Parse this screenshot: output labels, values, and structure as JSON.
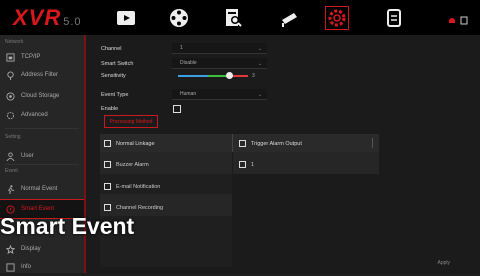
{
  "app": {
    "logo": "XVR",
    "version": "5.0"
  },
  "nav": [
    {
      "icon": "playback-icon"
    },
    {
      "icon": "film-reel-icon"
    },
    {
      "icon": "search-record-icon"
    },
    {
      "icon": "camera-icon"
    },
    {
      "icon": "settings-icon",
      "active": true
    },
    {
      "icon": "document-icon"
    }
  ],
  "sidebar": {
    "section_network": "Network",
    "items": [
      {
        "label": "TCP/IP",
        "icon": "network-port-icon"
      },
      {
        "label": "Address Filter",
        "icon": "location-pin-icon"
      },
      {
        "label": "Cloud Storage",
        "icon": "cloud-icon"
      },
      {
        "label": "Advanced",
        "icon": "advanced-icon"
      }
    ],
    "section_setting": "Setting",
    "user": {
      "label": "User",
      "icon": "user-icon"
    },
    "section_event": "Event",
    "normal_event": {
      "label": "Normal Event",
      "icon": "run-icon"
    },
    "smart_event": {
      "label": "Smart Event",
      "icon": "shield-icon"
    },
    "display": {
      "label": "Display",
      "icon": "star-icon"
    },
    "bottom": {
      "label": "Info",
      "icon": "info-icon"
    }
  },
  "form": {
    "channel_label": "Channel",
    "channel_value": "1",
    "smart_switch_label": "Smart Switch",
    "smart_switch_value": "Disable",
    "sensitivity_label": "Sensitivity",
    "sensitivity_value": "3",
    "event_type_label": "Event Type",
    "event_type_value": "Human",
    "enable_label": "Enable",
    "tab_label": "Processing Method"
  },
  "table": {
    "normal_linkage": "Normal Linkage",
    "trigger_alarm_output": "Trigger Alarm Output",
    "left_rows": [
      "Buzzer Alarm",
      "E-mail Notification",
      "Channel Recording"
    ],
    "right_rows": [
      "1"
    ]
  },
  "overlay_title": "Smart Event",
  "apply_label": "Apply",
  "colors": {
    "accent": "#c8191f"
  }
}
